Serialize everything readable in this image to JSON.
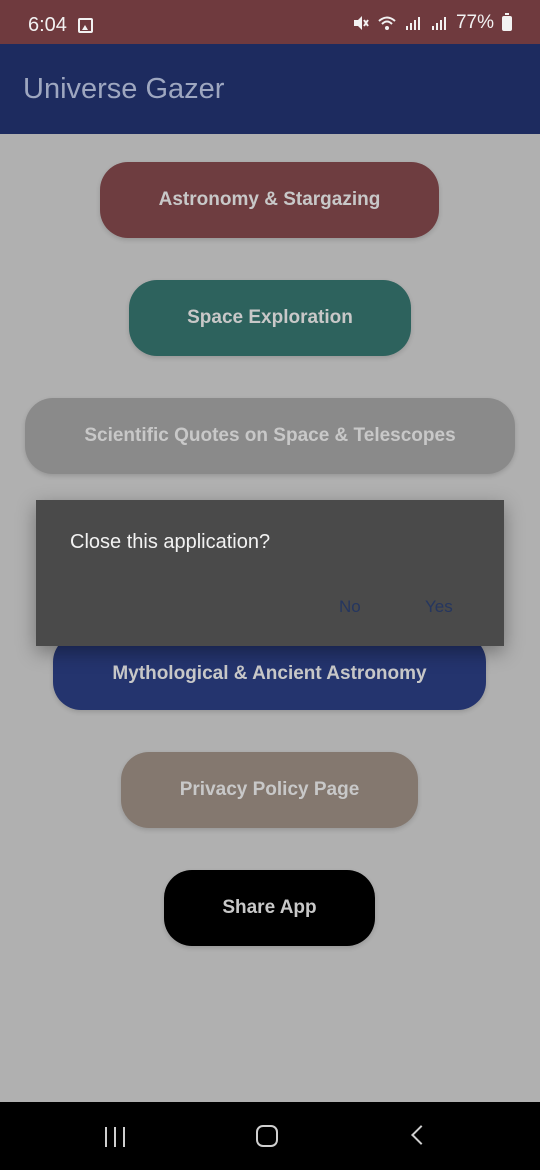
{
  "status_bar": {
    "time": "6:04",
    "battery": "77%",
    "icons": [
      "image-icon",
      "mute-icon",
      "wifi-icon",
      "signal-icon",
      "signal-icon",
      "battery-icon"
    ]
  },
  "app_bar": {
    "title": "Universe Gazer"
  },
  "menu": {
    "astronomy_label": "Astronomy & Stargazing",
    "space_label": "Space Exploration",
    "quotes_label": "Scientific Quotes on Space & Telescopes",
    "myth_label": "Mythological & Ancient Astronomy",
    "privacy_label": "Privacy Policy Page",
    "share_label": "Share App"
  },
  "dialog": {
    "message": "Close this application?",
    "no_label": "No",
    "yes_label": "Yes"
  },
  "colors": {
    "status_bar": "#6f3a3e",
    "app_bar": "#1d2b5f",
    "background": "#b0b0b0",
    "astronomy_button": "#6e3d40",
    "space_button": "#2d625d",
    "quotes_button": "#8a8a8a",
    "myth_button": "#24346e",
    "privacy_button": "#84786f",
    "share_button": "#000000",
    "dialog": "#4a4a4a"
  }
}
